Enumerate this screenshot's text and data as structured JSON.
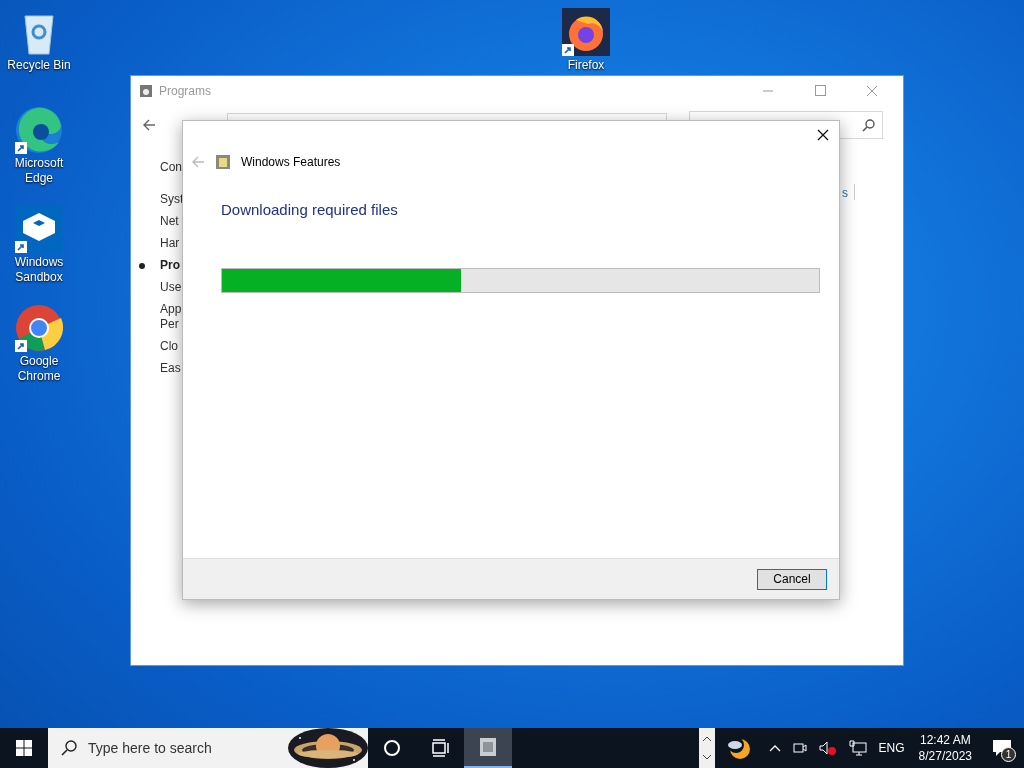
{
  "desktop_icons": [
    {
      "label": "Recycle Bin",
      "kind": "recycle"
    },
    {
      "label": "Microsoft Edge",
      "kind": "edge"
    },
    {
      "label": "Windows Sandbox",
      "kind": "sandbox"
    },
    {
      "label": "Google Chrome",
      "kind": "chrome"
    },
    {
      "label": "Firefox",
      "kind": "firefox"
    }
  ],
  "programs_window": {
    "title": "Programs",
    "nav_items": [
      {
        "label": "Con",
        "selected": false
      },
      {
        "label": "Syst",
        "selected": false
      },
      {
        "label": "Net",
        "selected": false
      },
      {
        "label": "Har",
        "selected": false
      },
      {
        "label": "Pro",
        "selected": true
      },
      {
        "label": "Use",
        "selected": false
      },
      {
        "label": "App\nPer",
        "selected": false
      },
      {
        "label": "Clo",
        "selected": false
      },
      {
        "label": "Eas",
        "selected": false
      }
    ],
    "link_fragment": "s"
  },
  "dialog": {
    "title": "Windows Features",
    "heading": "Downloading required files",
    "progress": {
      "level": 0.4
    },
    "buttons": [
      "Cancel"
    ]
  },
  "taskbar": {
    "search_placeholder": "Type here to search",
    "language": "ENG",
    "time": "12:42 AM",
    "date": "8/27/2023",
    "notification_count": "1"
  }
}
